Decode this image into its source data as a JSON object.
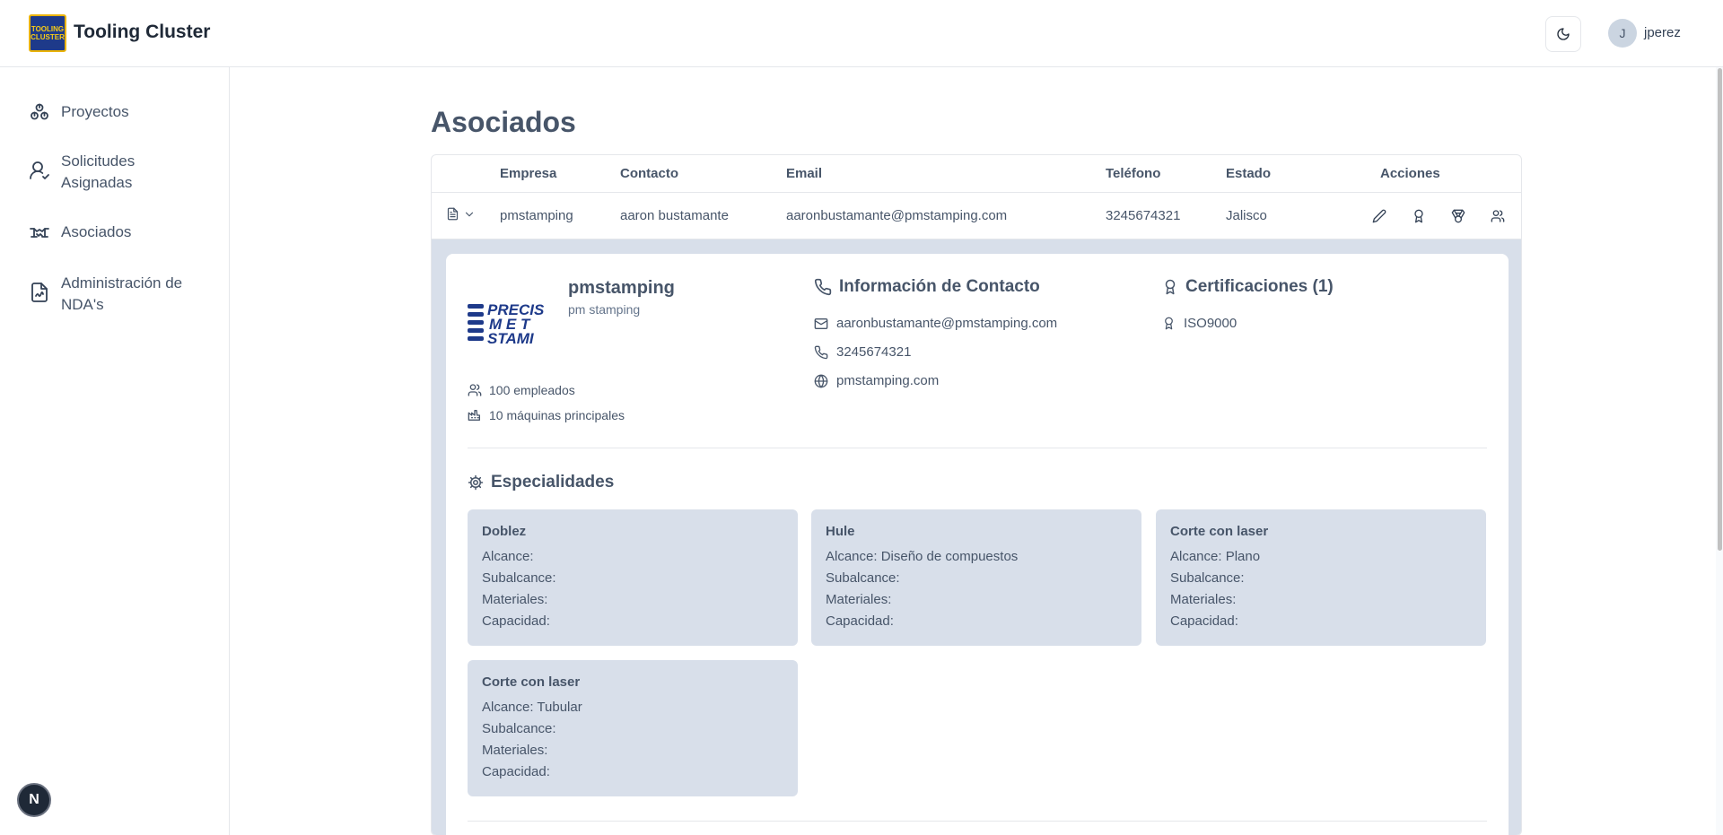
{
  "app": {
    "logo_text": [
      "TOOLING",
      "CLUSTER"
    ],
    "title": "Tooling Cluster"
  },
  "user": {
    "initial": "J",
    "name": "jperez"
  },
  "sidebar": {
    "items": [
      {
        "label": "Proyectos",
        "icon": "boxes-icon"
      },
      {
        "label": "Solicitudes Asignadas",
        "icon": "user-check-icon"
      },
      {
        "label": "Asociados",
        "icon": "handshake-icon"
      },
      {
        "label": "Administración de NDA's",
        "icon": "file-signature-icon"
      }
    ]
  },
  "fab_label": "N",
  "page": {
    "title": "Asociados"
  },
  "table": {
    "headers": {
      "empresa": "Empresa",
      "contacto": "Contacto",
      "email": "Email",
      "telefono": "Teléfono",
      "estado": "Estado",
      "acciones": "Acciones"
    },
    "row": {
      "empresa": "pmstamping",
      "contacto": "aaron bustamante",
      "email": "aaronbustamante@pmstamping.com",
      "telefono": "3245674321",
      "estado": "Jalisco"
    }
  },
  "detail": {
    "logo_text": [
      "PRECIS",
      "M E T",
      "STAMI"
    ],
    "company_name": "pmstamping",
    "company_sub": "pm stamping",
    "employees": "100 empleados",
    "machines": "10 máquinas principales",
    "contact_title": "Información de Contacto",
    "email": "aaronbustamante@pmstamping.com",
    "phone": "3245674321",
    "website": "pmstamping.com",
    "cert_title": "Certificaciones (1)",
    "certs": [
      "ISO9000"
    ],
    "spec_title": "Especialidades",
    "specialties": [
      {
        "name": "Doblez",
        "alcance": "Alcance:",
        "subalcance": "Subalcance:",
        "materiales": "Materiales:",
        "capacidad": "Capacidad:"
      },
      {
        "name": "Hule",
        "alcance": "Alcance: Diseño de compuestos",
        "subalcance": "Subalcance:",
        "materiales": "Materiales:",
        "capacidad": "Capacidad:"
      },
      {
        "name": "Corte con laser",
        "alcance": "Alcance: Plano",
        "subalcance": "Subalcance:",
        "materiales": "Materiales:",
        "capacidad": "Capacidad:"
      },
      {
        "name": "Corte con laser",
        "alcance": "Alcance: Tubular",
        "subalcance": "Subalcance:",
        "materiales": "Materiales:",
        "capacidad": "Capacidad:"
      }
    ]
  },
  "colors": {
    "accent_logo_bg": "#1e3a8a",
    "accent_logo_border": "#eab308",
    "expanded_bg": "#d8dfea",
    "text": "#475569"
  }
}
